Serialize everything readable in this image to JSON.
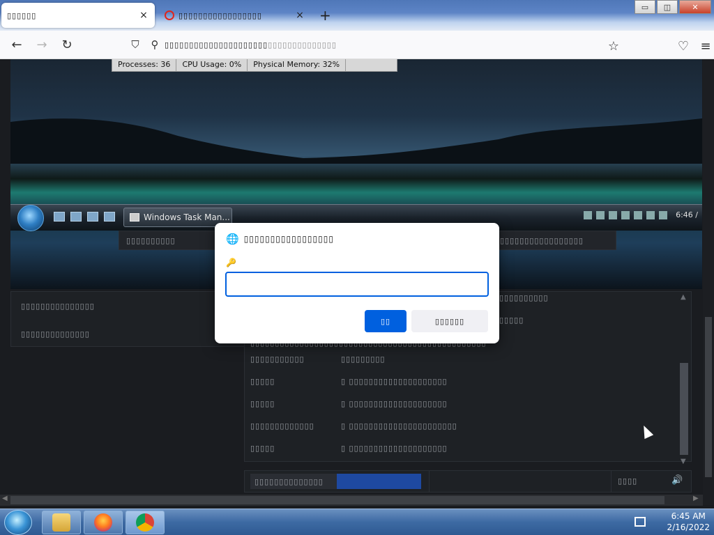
{
  "browser": {
    "tabs": [
      {
        "title": "▯▯▯▯▯▯",
        "active": true
      },
      {
        "title": "▯▯▯▯▯▯▯▯▯▯▯▯▯▯▯▯▯",
        "active": false
      }
    ],
    "new_tab": "+",
    "url": "▯▯▯▯▯▯▯▯▯▯▯▯▯▯▯▯▯▯▯▯▯",
    "url_tail": "▯▯▯▯▯▯▯▯▯▯▯▯▯▯",
    "window_controls": {
      "minimize": "▭",
      "restore": "◫",
      "close": "✕"
    }
  },
  "remote_desktop": {
    "task_manager_status": {
      "processes": "Processes: 36",
      "cpu": "CPU Usage: 0%",
      "memory": "Physical Memory: 32%"
    },
    "taskbar_button": "Windows Task Man...",
    "clock": "6:46 /"
  },
  "form": {
    "top_left_label": "▯▯▯▯▯▯▯▯▯▯",
    "top_right_label": "▯▯▯▯▯▯▯▯▯▯▯▯▯▯▯▯▯",
    "left_rows": [
      "▯▯▯▯▯▯▯▯▯▯▯▯▯▯▯",
      "▯▯▯▯▯▯▯▯▯▯▯▯▯▯"
    ],
    "right_header": "▯▯▯▯▯▯▯▯▯▯",
    "right_rows": [
      {
        "a": "▯▯▯▯▯",
        "b": "▯▯▯"
      },
      {
        "a": "▯▯▯▯▯▯▯▯▯▯▯▯▯▯▯▯▯▯▯▯▯▯▯▯▯▯▯▯▯▯▯▯▯▯▯▯▯▯▯▯▯▯▯▯▯▯▯▯",
        "b": ""
      },
      {
        "a": "▯▯▯▯▯▯▯▯▯▯▯",
        "b": "▯▯▯▯▯▯▯▯▯"
      },
      {
        "a": "▯▯▯▯▯",
        "b": "▯ ▯▯▯▯▯▯▯▯▯▯▯▯▯▯▯▯▯▯▯▯"
      },
      {
        "a": "▯▯▯▯▯",
        "b": "▯ ▯▯▯▯▯▯▯▯▯▯▯▯▯▯▯▯▯▯▯▯"
      },
      {
        "a": "▯▯▯▯▯▯▯▯▯▯▯▯▯",
        "b": "▯ ▯▯▯▯▯▯▯▯▯▯▯▯▯▯▯▯▯▯▯▯▯▯"
      },
      {
        "a": "▯▯▯▯▯",
        "b": "▯ ▯▯▯▯▯▯▯▯▯▯▯▯▯▯▯▯▯▯▯▯"
      }
    ],
    "progress_text": "▯▯▯▯▯▯▯▯▯▯▯▯▯▯",
    "bottom_label": "▯▯▯▯",
    "volume": "🔊"
  },
  "dialog": {
    "title": "▯▯▯▯▯▯▯▯▯▯▯▯▯▯▯▯▯",
    "input_value": "",
    "ok": "▯▯",
    "cancel": "▯▯▯▯▯▯"
  },
  "host_taskbar": {
    "time": "6:45 AM",
    "date": "2/16/2022"
  }
}
